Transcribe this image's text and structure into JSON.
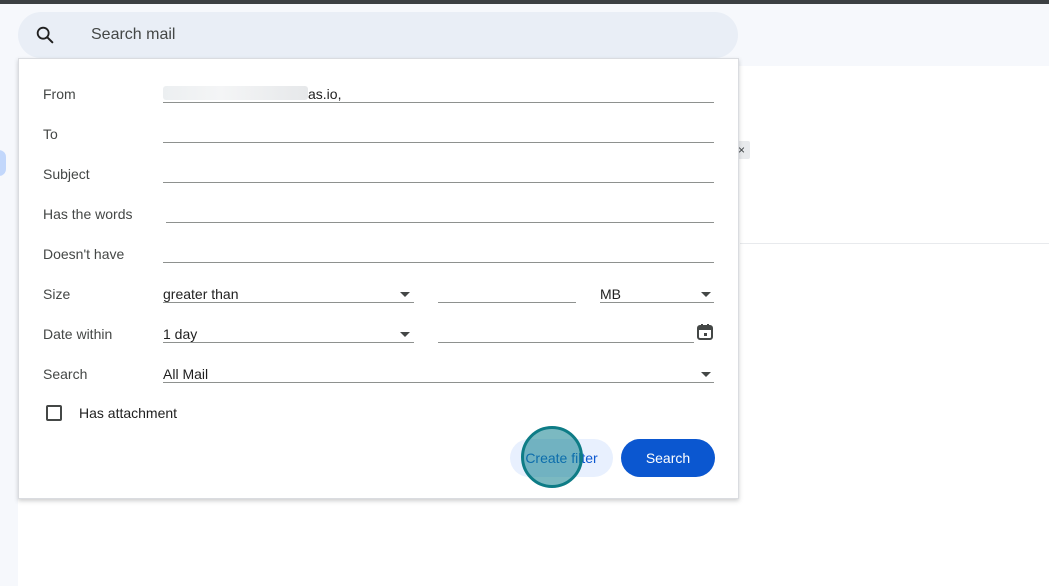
{
  "search": {
    "placeholder": "Search mail",
    "icon": "search-icon"
  },
  "filter_panel": {
    "fields": [
      {
        "label": "From",
        "value": "as.io,"
      },
      {
        "label": "To",
        "value": ""
      },
      {
        "label": "Subject",
        "value": ""
      },
      {
        "label": "Has the words",
        "value": ""
      },
      {
        "label": "Doesn't have",
        "value": ""
      }
    ],
    "size": {
      "label": "Size",
      "operator": "greater than",
      "amount": "",
      "unit": "MB"
    },
    "date_within": {
      "label": "Date within",
      "range": "1 day",
      "date": "",
      "icon": "calendar-icon"
    },
    "search_in": {
      "label": "Search",
      "value": "All Mail"
    },
    "has_attachment": {
      "label": "Has attachment",
      "checked": false
    },
    "buttons": {
      "create_filter": "Create filter",
      "search": "Search"
    }
  },
  "background": {
    "close_chip": "×"
  },
  "colors": {
    "primary": "#0b57d0",
    "filter_button_bg": "#e8f0fe",
    "search_bar_bg": "#e9eef6",
    "click_indicator": "#0e7c86"
  }
}
